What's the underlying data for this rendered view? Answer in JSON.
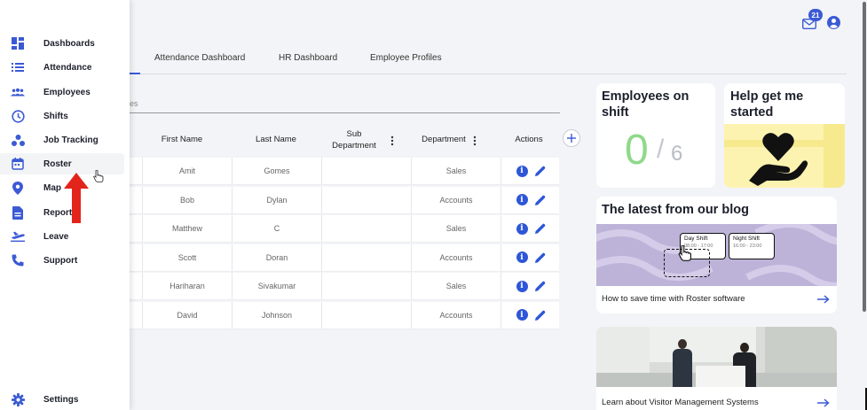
{
  "sidebar": {
    "items": [
      {
        "label": "Dashboards",
        "icon": "dashboard-icon"
      },
      {
        "label": "Attendance",
        "icon": "list-icon"
      },
      {
        "label": "Employees",
        "icon": "people-icon"
      },
      {
        "label": "Shifts",
        "icon": "clock-icon"
      },
      {
        "label": "Job Tracking",
        "icon": "job-tracking-icon"
      },
      {
        "label": "Roster",
        "icon": "calendar-icon"
      },
      {
        "label": "Map",
        "icon": "map-pin-icon"
      },
      {
        "label": "Report",
        "icon": "document-icon"
      },
      {
        "label": "Leave",
        "icon": "plane-icon"
      },
      {
        "label": "Support",
        "icon": "phone-icon"
      }
    ],
    "settings_label": "Settings",
    "active": "Roster"
  },
  "header": {
    "notification_count": "21"
  },
  "tabs": [
    "Attendance Dashboard",
    "HR Dashboard",
    "Employee Profiles"
  ],
  "filter_placeholder_fragment": "es",
  "table": {
    "columns": [
      "First Name",
      "Last Name",
      "Sub Department",
      "Department",
      "Actions"
    ],
    "rows": [
      {
        "first": "Amit",
        "last": "Gomes",
        "sub": "",
        "dept": "Sales"
      },
      {
        "first": "Bob",
        "last": "Dylan",
        "sub": "",
        "dept": "Accounts"
      },
      {
        "first": "Matthew",
        "last": "C",
        "sub": "",
        "dept": "Sales"
      },
      {
        "first": "Scott",
        "last": "Doran",
        "sub": "",
        "dept": "Accounts"
      },
      {
        "first": "Hariharan",
        "last": "Sivakumar",
        "sub": "",
        "dept": "Sales"
      },
      {
        "first": "David",
        "last": "Johnson",
        "sub": "",
        "dept": "Accounts"
      }
    ]
  },
  "cards": {
    "employees_on_shift": {
      "title": "Employees on shift",
      "count": "0",
      "total": "6"
    },
    "help": {
      "title": "Help get me started"
    },
    "blog": {
      "title": "The latest from our blog",
      "post1": {
        "day_shift": "Day Shift",
        "day_time": "08:00 - 17:00",
        "night_shift": "Night Shift",
        "night_time": "16:00 - 23:00",
        "caption": "How to save time with Roster software"
      },
      "post2": {
        "caption": "Learn about Visitor Management Systems"
      }
    }
  },
  "colors": {
    "accent": "#3b5ad4",
    "green": "#8fd98a",
    "purple": "#bdb3d9",
    "yellow": "#f7e98e",
    "arrow_red": "#e3241b"
  }
}
